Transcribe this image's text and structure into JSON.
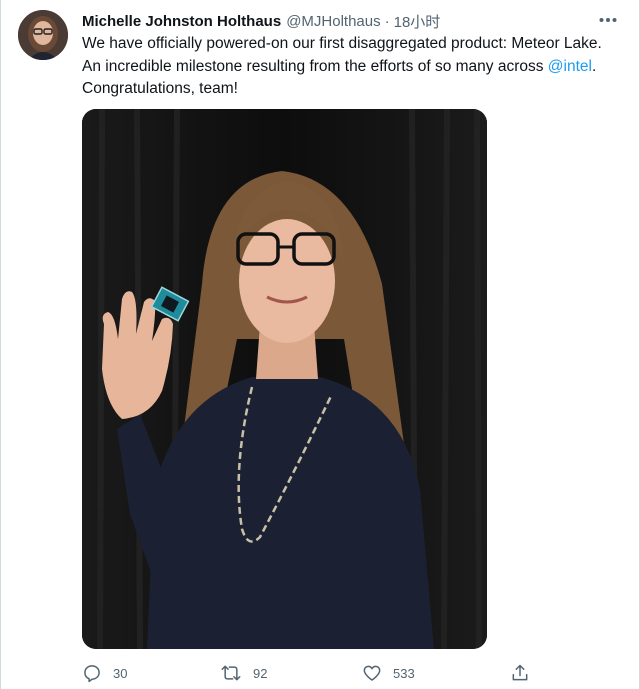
{
  "tweet": {
    "author_name": "Michelle Johnston Holthaus",
    "handle": "@MJHolthaus",
    "separator": "·",
    "time": "18小时",
    "text_before": "We have officially powered-on our first disaggregated product: Meteor Lake. An incredible milestone resulting from the efforts of so many across ",
    "mention": "@intel",
    "text_after": ". Congratulations, team!",
    "image_alt": "Woman holding a Meteor Lake chip in front of a dark curtain"
  },
  "actions": {
    "replies": "30",
    "retweets": "92",
    "likes": "533"
  },
  "icons": {
    "more": "more-horizontal-icon",
    "reply": "reply-icon",
    "retweet": "retweet-icon",
    "like": "heart-icon",
    "share": "share-icon"
  },
  "colors": {
    "accent": "#1d9bf0",
    "secondary_text": "#536471",
    "primary_text": "#0f1419"
  }
}
